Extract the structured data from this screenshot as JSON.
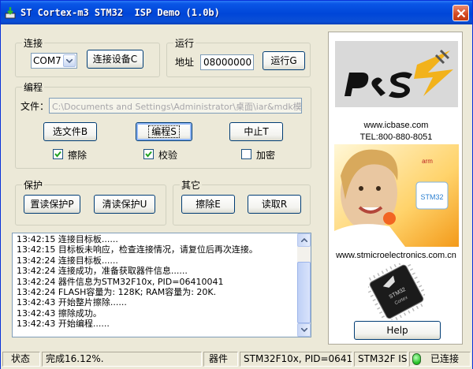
{
  "window": {
    "title": "ST Cortex-m3 STM32  ISP Demo (1.0b)"
  },
  "connect": {
    "legend": "连接",
    "port_value": "COM7",
    "connect_button": "连接设备C"
  },
  "run": {
    "legend": "运行",
    "address_label": "地址",
    "address_value": "08000000",
    "run_button": "运行G"
  },
  "program": {
    "legend": "编程",
    "file_label": "文件：",
    "file_path": "C:\\Documents and Settings\\Administrator\\桌面\\iar&mdk模板\\0Te",
    "select_file_button": "选文件B",
    "program_button": "编程S",
    "abort_button": "中止T",
    "erase_label": "擦除",
    "erase_checked": true,
    "verify_label": "校验",
    "verify_checked": true,
    "encrypt_label": "加密",
    "encrypt_checked": false
  },
  "protect": {
    "legend": "保护",
    "set_read_protect_button": "置读保护P",
    "clear_read_protect_button": "清读保护U"
  },
  "other": {
    "legend": "其它",
    "erase_button": "擦除E",
    "read_button": "读取R"
  },
  "log": {
    "lines": [
      "13:42:15 连接目标板......",
      "13:42:15 目标板未响应，检查连接情况，请复位后再次连接。",
      "13:42:24 连接目标板......",
      "13:42:24 连接成功，准备获取器件信息......",
      "13:42:24 器件信息为STM32F10x, PID=06410041",
      "13:42:24 FLASH容量为: 128K; RAM容量为: 20K.",
      "13:42:43 开始整片擦除......",
      "13:42:43 擦除成功。",
      "13:42:43 开始编程......"
    ]
  },
  "sidebar": {
    "website_1": "www.icbase.com",
    "tel": "TEL:800-880-8051",
    "website_2": "www.stmicroelectronics.com.cn",
    "help_button": "Help"
  },
  "statusbar": {
    "status_label": "状态",
    "status_text": "完成16.12%.",
    "device_label": "器件",
    "device_text": "STM32F10x, PID=06410041",
    "isp_label": "STM32F ISP",
    "connection_text": "已连接",
    "connection_color": "#22c022"
  },
  "progress_percent": 16.12
}
